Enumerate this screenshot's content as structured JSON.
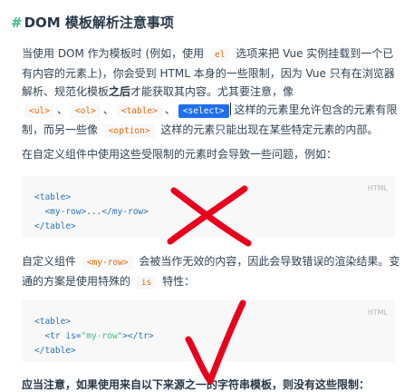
{
  "heading": {
    "hash": "#",
    "title": "DOM 模板解析注意事项"
  },
  "para1": {
    "t1": "当使用 DOM 作为模板时 (例如，使用 ",
    "code_el": "el",
    "t2": " 选项来把 Vue 实例挂载到一个已有内容的元素上)，你会受到 HTML 本身的一些限制，因为 Vue 只有在浏览器解析、规范化模板",
    "bold": "之后",
    "t3": "才能获取其内容。尤其要注意，像",
    "code_ul": "<ul>",
    "sep1": "、",
    "code_ol": "<ol>",
    "sep2": "、",
    "code_table": "<table>",
    "sep3": "、",
    "code_select": "<select>",
    "t4": " 这样的元素里允许包含的元素有限制，而另一些像 ",
    "code_option": "<option>",
    "t5": " 这样的元素只能出现在某些特定元素的内部。"
  },
  "para2": {
    "text": "在自定义组件中使用这些受限制的元素时会导致一些问题，例如："
  },
  "code1": {
    "lang": "HTML",
    "line1": "<table>",
    "line2_open": "<my-row>",
    "line2_mid": "...",
    "line2_close": "</my-row>",
    "line3": "</table>"
  },
  "para3": {
    "t1": "自定义组件 ",
    "code_myrow": "<my-row>",
    "t2": " 会被当作无效的内容，因此会导致错误的渲染结果。变通的方案是使用特殊的 ",
    "code_is": "is",
    "t3": " 特性："
  },
  "code2": {
    "lang": "HTML",
    "line1": "<table>",
    "line2_open": "<tr",
    "line2_attr": " is=",
    "line2_val": "\"my-row\"",
    "line2_close": "></tr>",
    "line3": "</table>"
  },
  "bottom": {
    "text": "应当注意，如果使用来自以下来源之一的字符串模板，则没有这些限制："
  },
  "colors": {
    "accent": "#42b983",
    "annotation": "#e8001c",
    "code_text": "#e96900",
    "selection": "#1f6feb"
  }
}
